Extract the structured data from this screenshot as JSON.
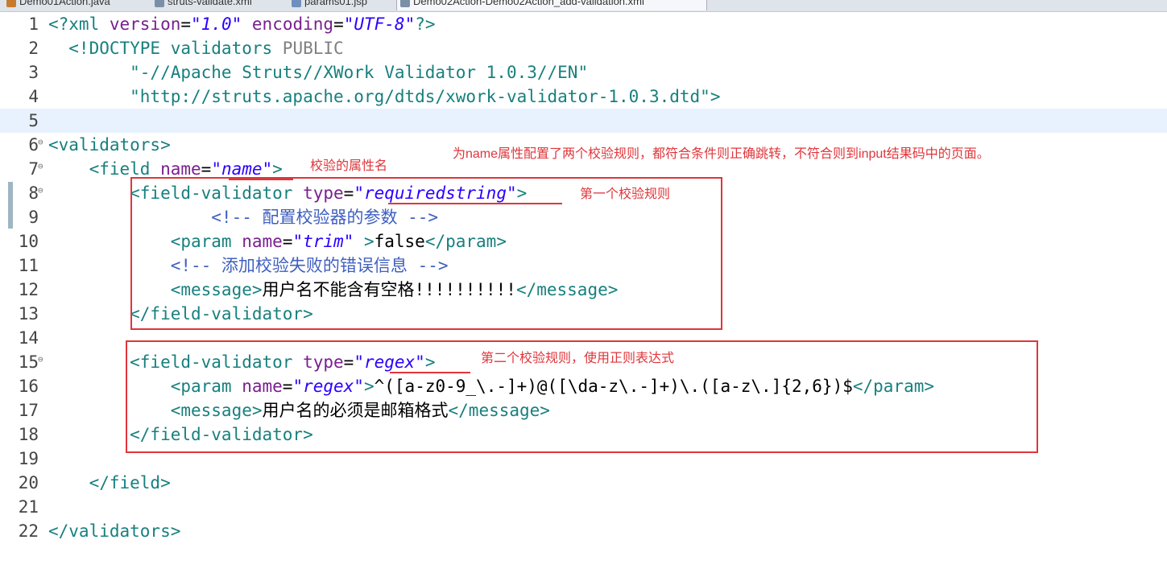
{
  "tabs": [
    {
      "label": "Demo01Action.java",
      "icon": "java-file-icon",
      "color": "#c77b2f"
    },
    {
      "label": "struts-validate.xml",
      "icon": "xml-file-icon",
      "color": "#7a8fa8"
    },
    {
      "label": "params01.jsp",
      "icon": "jsp-file-icon",
      "color": "#6f8fbf"
    },
    {
      "label": "Demo02Action-Demo02Action_add-validation.xml",
      "icon": "xml-file-icon",
      "color": "#7a8fa8"
    }
  ],
  "line_numbers": [
    "1",
    "2",
    "3",
    "4",
    "5",
    "6",
    "7",
    "8",
    "9",
    "10",
    "11",
    "12",
    "13",
    "14",
    "15",
    "16",
    "17",
    "18",
    "19",
    "20",
    "21",
    "22"
  ],
  "code": {
    "l1": {
      "p1": "<?xml ",
      "p2": "version",
      "p3": "=",
      "p4": "\"1.0\"",
      "p5": " ",
      "p6": "encoding",
      "p7": "=",
      "p8": "\"UTF-8\"",
      "p9": "?>"
    },
    "l2": {
      "p1": "  <!DOCTYPE ",
      "p2": "validators",
      "p3": " PUBLIC"
    },
    "l3": {
      "p1": "        \"-//Apache Struts//XWork Validator 1.0.3//EN\""
    },
    "l4": {
      "p1": "        \"http://struts.apache.org/dtds/xwork-validator-1.0.3.dtd\"",
      "p2": ">"
    },
    "l6": {
      "p1": "<validators>"
    },
    "l7": {
      "p1": "    <field ",
      "p2": "name",
      "p3": "=",
      "p4": "\"name\"",
      "p5": ">"
    },
    "l8": {
      "p1": "        <field-validator ",
      "p2": "type",
      "p3": "=",
      "p4": "\"requiredstring\"",
      "p5": ">"
    },
    "l9": {
      "p1": "                <!-- 配置校验器的参数 -->"
    },
    "l10": {
      "p1": "            <param ",
      "p2": "name",
      "p3": "=",
      "p4": "\"trim\"",
      "p5": " >",
      "p6": "false",
      "p7": "</param>"
    },
    "l11": {
      "p1": "            <!-- 添加校验失败的错误信息 -->"
    },
    "l12": {
      "p1": "            <message>",
      "p2": "用户名不能含有空格!!!!!!!!!!",
      "p3": "</message>"
    },
    "l13": {
      "p1": "        </field-validator>"
    },
    "l15": {
      "p1": "        <field-validator ",
      "p2": "type",
      "p3": "=",
      "p4": "\"regex\"",
      "p5": ">"
    },
    "l16": {
      "p1": "            <param ",
      "p2": "name",
      "p3": "=",
      "p4": "\"regex\"",
      "p5": ">",
      "p6": "^([a-z0-9_\\.-]+)@([\\da-z\\.-]+)\\.([a-z\\.]{2,6})$",
      "p7": "</param>"
    },
    "l17": {
      "p1": "            <message>",
      "p2": "用户名的必须是邮箱格式",
      "p3": "</message>"
    },
    "l18": {
      "p1": "        </field-validator>"
    },
    "l20": {
      "p1": "    </field>"
    },
    "l22": {
      "p1": "</validators>"
    }
  },
  "annotations": {
    "top_note": "为name属性配置了两个校验规则，都符合条件则正确跳转，不符合则到input结果码中的页面。",
    "name_note": "校验的属性名",
    "rule1_note": "第一个校验规则",
    "rule2_note": "第二个校验规则，使用正则表达式"
  },
  "colors": {
    "annotation": "#e0353a",
    "tag": "#17807e",
    "attribute": "#7a1f8f",
    "value": "#2a00ff",
    "comment": "#3f5fbf",
    "current_line": "#e8f2fe"
  }
}
